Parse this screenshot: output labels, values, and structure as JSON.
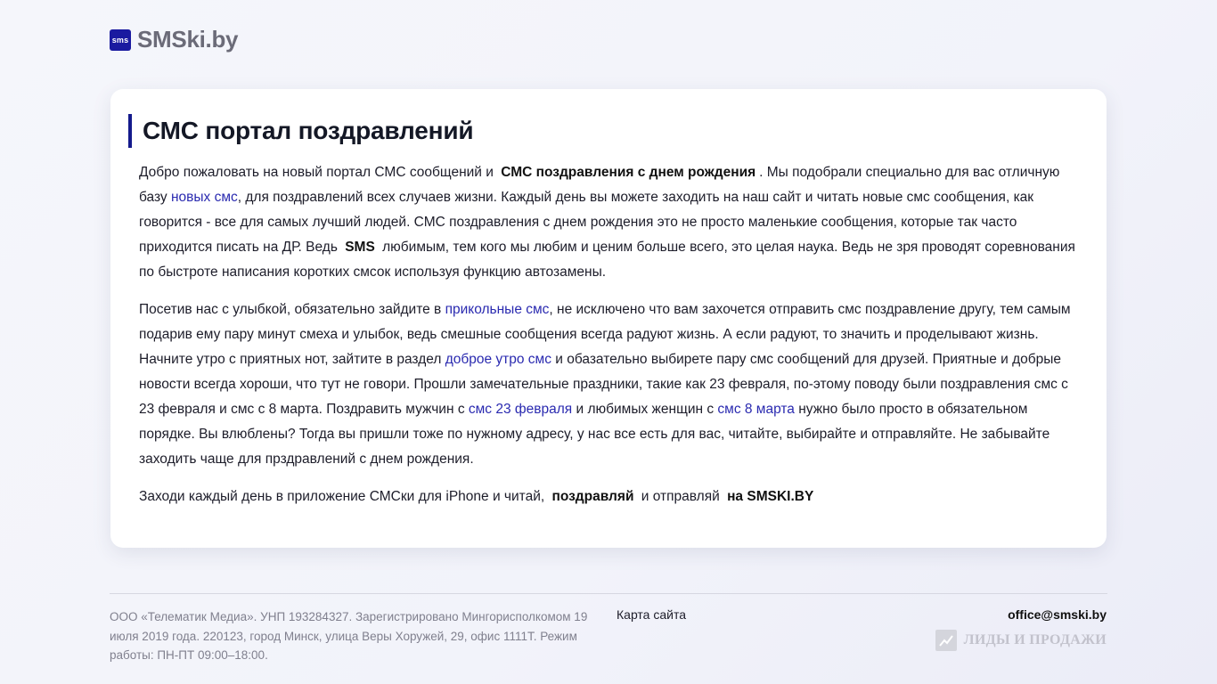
{
  "header": {
    "logo_badge": "sms",
    "logo_text": "SMSki.by"
  },
  "main": {
    "title": "СМС портал поздравлений",
    "p1": {
      "t1": "Добро пожаловать на новый портал СМС сообщений и ",
      "b1": "СМС поздравления с днем рождения",
      "t2": ". Мы подобрали специально для вас отличную базу ",
      "l1": "новых смс",
      "t3": ", для поздравлений всех случаев жизни. Каждый день вы можете заходить на наш сайт и читать новые смс сообщения, как говорится - все для самых лучший людей. СМС поздравления с днем рождения это не просто маленькие сообщения, которые так часто приходится писать на ДР. Ведь ",
      "b2": "SMS",
      "t4": " любимым, тем кого мы любим и ценим больше всего, это целая наука. Ведь не зря проводят соревнования по быстроте написания коротких смсок используя функцию автозамены."
    },
    "p2": {
      "t1": "Посетив нас с улыбкой, обязательно зайдите в ",
      "l1": "прикольные смс",
      "t2": ", не исключено что вам захочется отправить смс поздравление другу, тем самым подарив ему пару минут смеха и улыбок, ведь смешные сообщения всегда радуют жизнь. А если радуют, то значить и проделывают жизнь. Начните утро с приятных нот, зайтите в раздел ",
      "l2": "доброе утро смс",
      "t3": " и обазательно выбирете пару смс сообщений для друзей. Приятные и добрые новости всегда хороши, что тут не говори. Прошли замечательные праздники, такие как 23 февраля, по-этому поводу были поздравления смс с 23 февраля и смс с 8 марта. Поздравить мужчин с ",
      "l3": "смс 23 февраля",
      "t4": " и любимых женщин с ",
      "l4": "смс 8 марта",
      "t5": " нужно было просто в обязательном порядке. Вы влюблены? Тогда вы пришли тоже по нужному адресу, у нас все есть для вас, читайте, выбирайте и отправляйте. Не забывайте заходить чаще для прздравлений с днем рождения."
    },
    "p3": {
      "t1": "Заходи каждый день в приложение СМСки для iPhone и читай, ",
      "b1": "поздравляй",
      "t2": " и отправляй ",
      "b2": "на SMSKI.BY"
    }
  },
  "footer": {
    "legal": "ООО «Телематик Медиа». УНП 193284327. Зарегистрировано Мингорисполкомом 19 июля 2019 года. 220123, город Минск, улица Веры Хоружей, 29, офис 1111Т. Режим работы: ПН-ПТ 09:00–18:00.",
    "sitemap_label": "Карта сайта",
    "email": "office@smski.by",
    "partner_label": "ЛИДЫ И ПРОДАЖИ",
    "partner_icon": "chart-trend-icon"
  },
  "colors": {
    "accent": "#141a8c",
    "link": "#2a2ab0",
    "logo_badge_bg": "#1a1aa0"
  }
}
